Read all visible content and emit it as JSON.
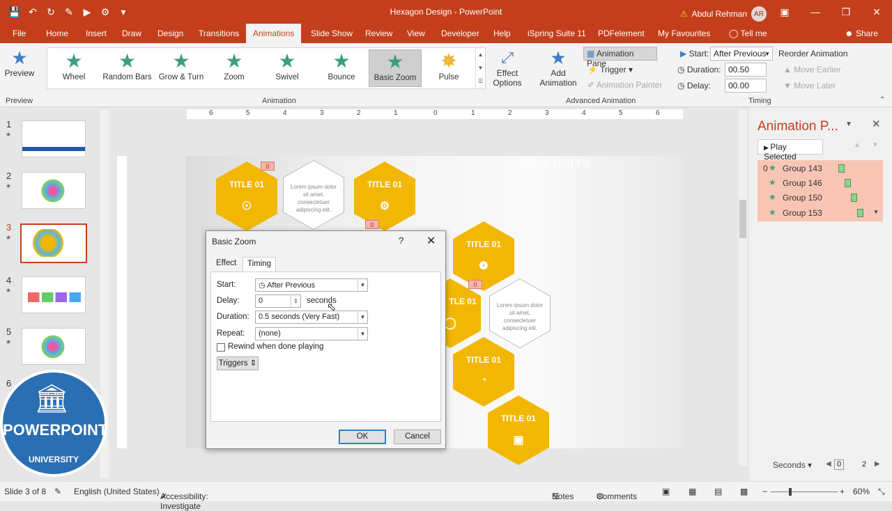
{
  "window": {
    "title": "Hexagon Design - PowerPoint",
    "user_name": "Abdul Rehman",
    "user_initials": "AR",
    "colors": {
      "accent": "#c43e1c",
      "animation_star": "#3e9c85",
      "hexagon": "#f2b705"
    }
  },
  "tabs": [
    "File",
    "Home",
    "Insert",
    "Draw",
    "Design",
    "Transitions",
    "Animations",
    "Slide Show",
    "Review",
    "View",
    "Developer",
    "Help",
    "iSpring Suite 11",
    "PDFelement",
    "My Favourites",
    "Tell me",
    "Share"
  ],
  "ribbon": {
    "preview": "Preview",
    "preview_group": "Preview",
    "animations": [
      "Wheel",
      "Random Bars",
      "Grow & Turn",
      "Zoom",
      "Swivel",
      "Bounce",
      "Basic Zoom",
      "Pulse"
    ],
    "animation_group": "Animation",
    "effect_options_1": "Effect",
    "effect_options_2": "Options",
    "add_animation_1": "Add",
    "add_animation_2": "Animation",
    "animation_pane": "Animation Pane",
    "trigger": "Trigger",
    "animation_painter": "Animation Painter",
    "advanced_group": "Advanced Animation",
    "start_label": "Start:",
    "start_value": "After Previous",
    "duration_label": "Duration:",
    "duration_value": "00.50",
    "delay_label": "Delay:",
    "delay_value": "00.00",
    "reorder": "Reorder Animation",
    "move_earlier": "Move Earlier",
    "move_later": "Move Later",
    "timing_group": "Timing"
  },
  "slides": [
    {
      "num": "1"
    },
    {
      "num": "2"
    },
    {
      "num": "3"
    },
    {
      "num": "4"
    },
    {
      "num": "5"
    },
    {
      "num": "6"
    }
  ],
  "slide": {
    "watermark": "UNIVERSITY",
    "hex_title": "TITLE 01",
    "hex_title_partial": "TLE 01",
    "lorem": "Lorem ipsum dolor sit amet, consectetuer adipiscing elit.",
    "tag": "0"
  },
  "ruler": [
    "6",
    "5",
    "4",
    "3",
    "2",
    "1",
    "0",
    "1",
    "2",
    "3",
    "4",
    "5",
    "6"
  ],
  "animation_pane": {
    "title": "Animation P...",
    "play_selected": "Play Selected",
    "items": [
      {
        "index": "0",
        "name": "Group 143"
      },
      {
        "index": "",
        "name": "Group 146"
      },
      {
        "index": "",
        "name": "Group 150"
      },
      {
        "index": "",
        "name": "Group 153"
      }
    ],
    "seconds": "Seconds",
    "timeline_start": "0",
    "timeline_end": "2"
  },
  "dialog": {
    "title": "Basic Zoom",
    "help": "?",
    "tab_effect": "Effect",
    "tab_timing": "Timing",
    "start_label": "Start:",
    "start_value": "After Previous",
    "delay_label": "Delay:",
    "delay_value": "0",
    "delay_unit": "seconds",
    "duration_label": "Duration:",
    "duration_value": "0.5 seconds (Very Fast)",
    "repeat_label": "Repeat:",
    "repeat_value": "(none)",
    "rewind_label": "Rewind when done playing",
    "triggers": "Triggers",
    "ok": "OK",
    "cancel": "Cancel"
  },
  "logo": {
    "main": "POWERPOINT",
    "sub": "UNIVERSITY"
  },
  "status": {
    "slide_of": "Slide 3 of 8",
    "language": "English (United States)",
    "accessibility": "Accessibility: Investigate",
    "notes": "Notes",
    "comments": "Comments",
    "zoom": "60%"
  }
}
